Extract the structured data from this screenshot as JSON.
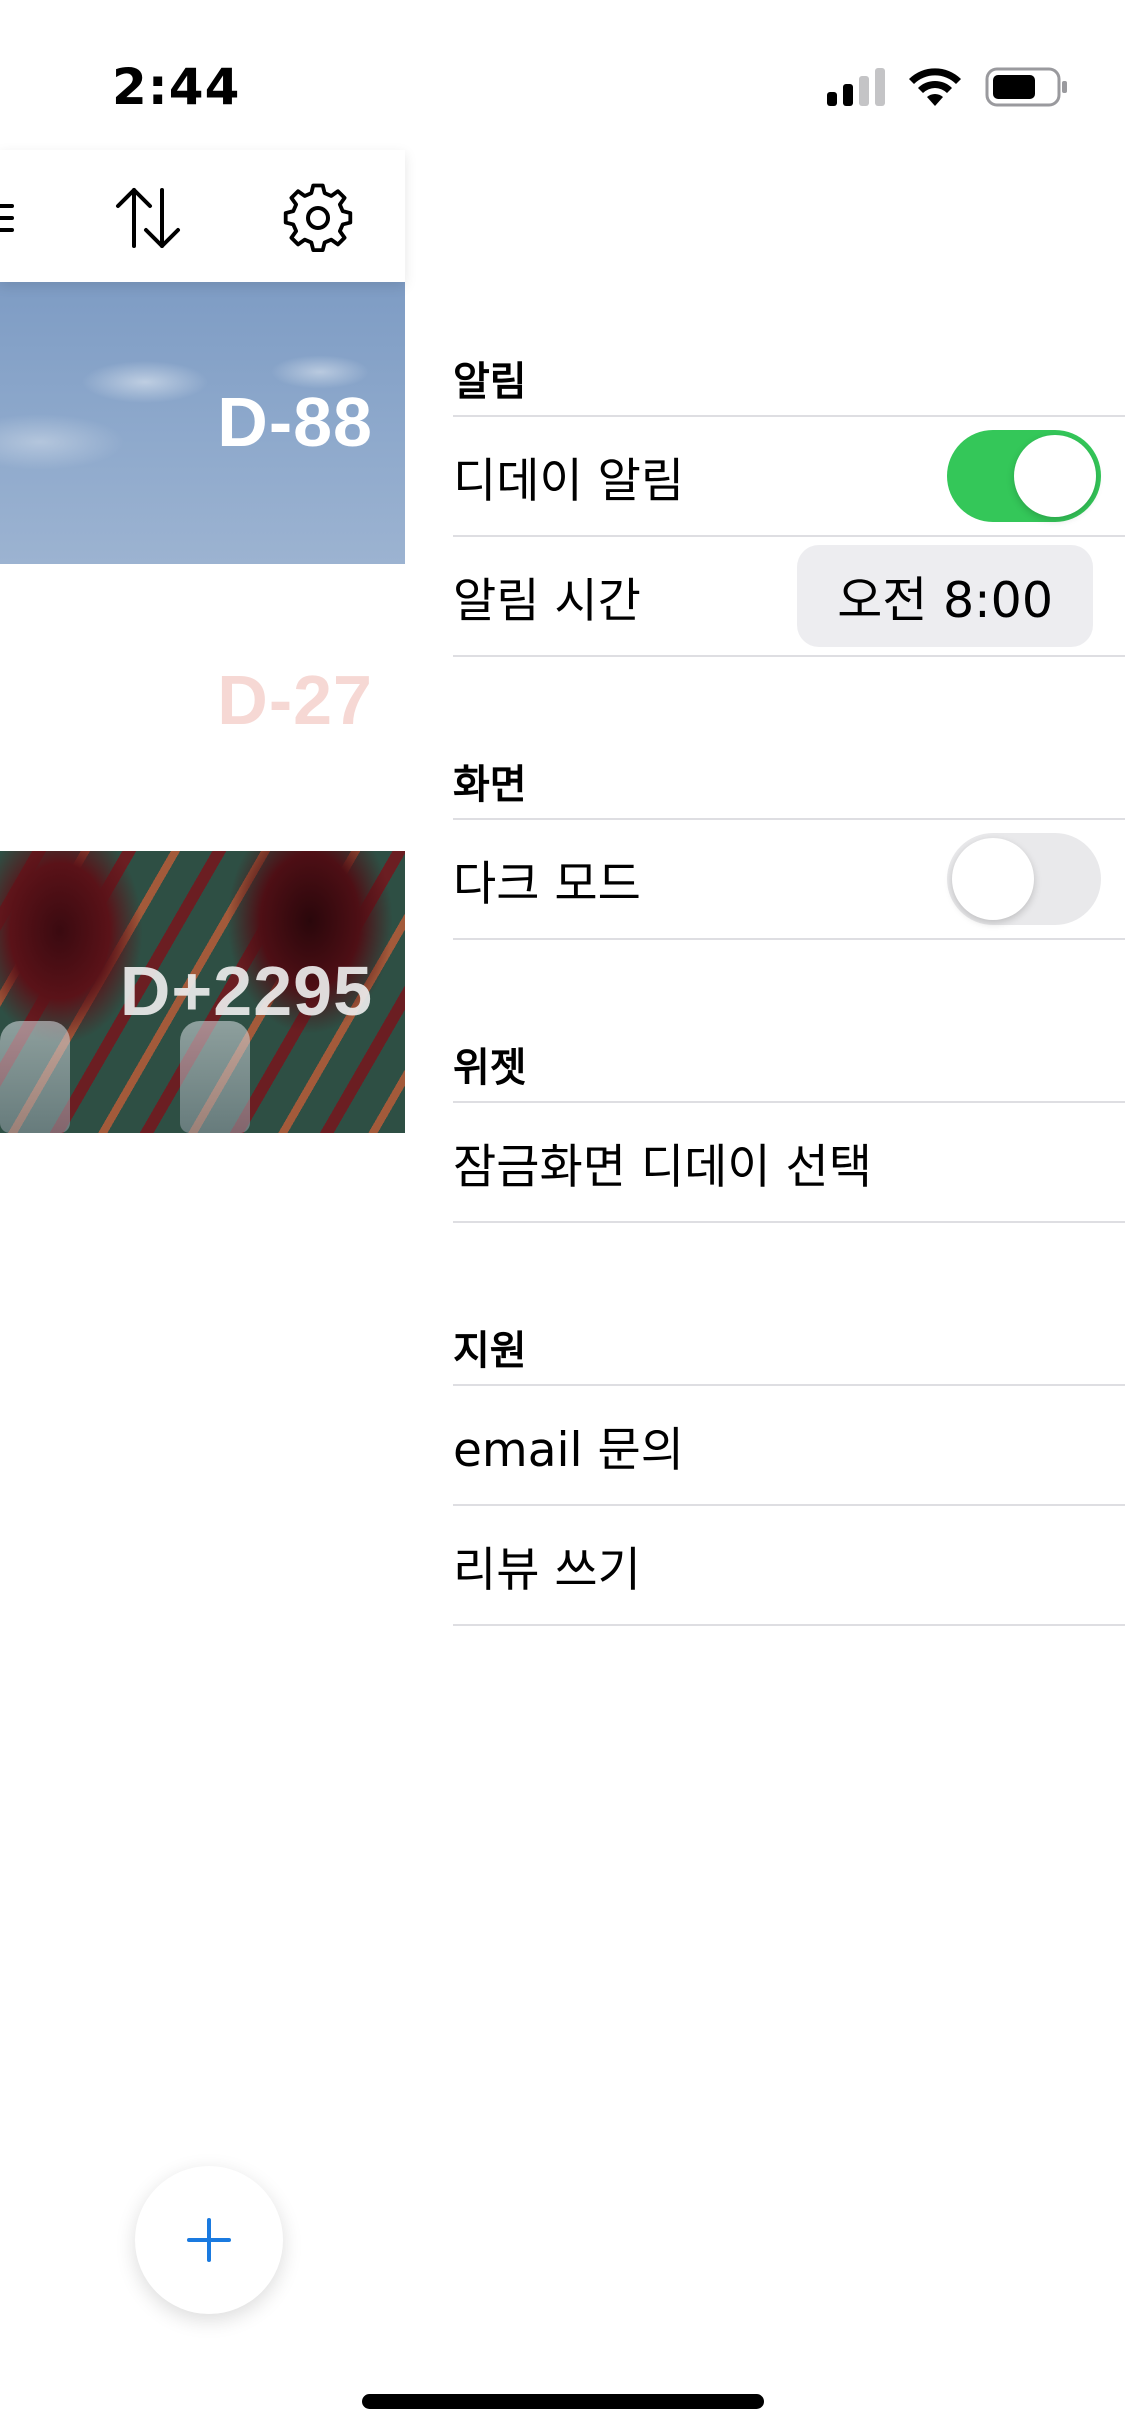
{
  "status_bar": {
    "time": "2:44"
  },
  "toolbar": {
    "icons": [
      "list-icon",
      "sort-icon",
      "gear-icon"
    ]
  },
  "ddays": [
    {
      "label": "D-88",
      "background": "sky"
    },
    {
      "label": "D-27",
      "background": "white"
    },
    {
      "label": "D+2295",
      "background": "wine-glasses"
    }
  ],
  "fab": {
    "icon": "plus-icon",
    "color": "#1a7ae0"
  },
  "settings": {
    "sections": {
      "alarm": {
        "header": "알림",
        "dday_alarm_label": "디데이 알림",
        "dday_alarm_on": true,
        "alarm_time_label": "알림 시간",
        "alarm_time_value": "오전 8:00"
      },
      "display": {
        "header": "화면",
        "dark_mode_label": "다크 모드",
        "dark_mode_on": false
      },
      "widget": {
        "header": "위젯",
        "lockscreen_label": "잠금화면 디데이 선택"
      },
      "support": {
        "header": "지원",
        "email_label": "email 문의",
        "review_label": "리뷰 쓰기"
      }
    }
  },
  "colors": {
    "toggle_on": "#34c759",
    "toggle_off": "#e9e9eb",
    "separator": "#dedee2"
  }
}
